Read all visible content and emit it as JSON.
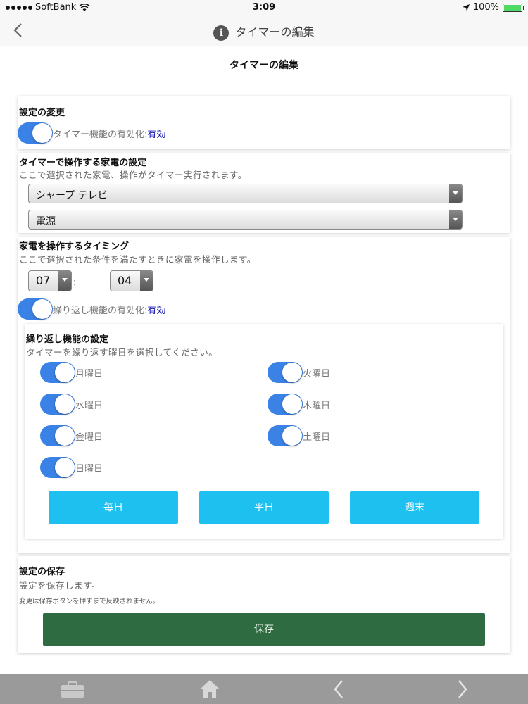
{
  "status_bar": {
    "carrier": "SoftBank",
    "time": "3:09",
    "battery": "100%"
  },
  "nav": {
    "title": "タイマーの編集",
    "back_icon": "chevron-left-icon",
    "info_icon": "info-icon"
  },
  "page_title": "タイマーの編集",
  "settings_change": {
    "heading": "設定の変更",
    "timer_enable": {
      "label": "タイマー機能の有効化:",
      "value": "有効",
      "on": true
    }
  },
  "appliance": {
    "heading": "タイマーで操作する家電の設定",
    "description": "ここで選択された家電、操作がタイマー実行されます。",
    "device_select": "シャープ テレビ",
    "operation_select": "電源"
  },
  "timing": {
    "heading": "家電を操作するタイミング",
    "description": "ここで選択された条件を満たすときに家電を操作します。",
    "hour": "07",
    "separator": ":",
    "minute": "04",
    "repeat_enable": {
      "label": "繰り返し機能の有効化:",
      "value": "有効",
      "on": true
    }
  },
  "repeat": {
    "heading": "繰り返し機能の設定",
    "description": "タイマーを繰り返す曜日を選択してください。",
    "days": [
      {
        "label": "月曜日",
        "on": true
      },
      {
        "label": "火曜日",
        "on": true
      },
      {
        "label": "水曜日",
        "on": true
      },
      {
        "label": "木曜日",
        "on": true
      },
      {
        "label": "金曜日",
        "on": true
      },
      {
        "label": "土曜日",
        "on": true
      },
      {
        "label": "日曜日",
        "on": true
      }
    ],
    "presets": {
      "daily": "毎日",
      "weekdays": "平日",
      "weekend": "週末"
    }
  },
  "save": {
    "heading": "設定の保存",
    "description": "設定を保存します。",
    "note": "変更は保存ボタンを押すまで反映されません。",
    "button_label": "保存"
  },
  "tab_bar": {
    "items": [
      "toolbox-icon",
      "home-icon",
      "chevron-left-icon",
      "chevron-right-icon"
    ]
  },
  "colors": {
    "toggle_on": "#3b82e6",
    "preset_button": "#1ec0f0",
    "save_button": "#2e6b40",
    "enabled_text": "#1a1ab5",
    "tab_bar": "#9a9a9a"
  }
}
